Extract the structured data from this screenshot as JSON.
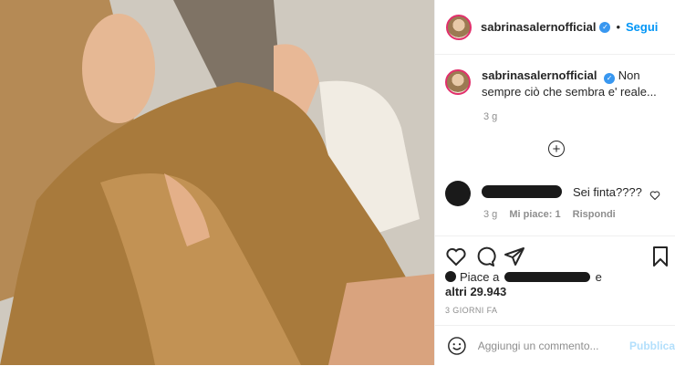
{
  "post": {
    "username": "sabrinasalernofficial",
    "verified": true,
    "follow_label": "Segui",
    "separator": "•",
    "caption": "Non sempre ciò che sembra e' reale...",
    "caption_time": "3 g",
    "comment": {
      "text": "Sei finta????",
      "time": "3 g",
      "likes": "Mi piace: 1",
      "reply": "Rispondi"
    },
    "likes_prefix": "Piace a",
    "likes_suffix": "e",
    "likes_count": "altri 29.943",
    "date": "3 GIORNI FA",
    "add_comment_placeholder": "Aggiungi un commento...",
    "publish_label": "Pubblica"
  },
  "icons": {
    "like": "heart-icon",
    "comment": "comment-icon",
    "share": "share-icon",
    "save": "bookmark-icon",
    "emoji": "emoji-icon",
    "more": "plus-circle-icon"
  },
  "colors": {
    "accent": "#0095f6",
    "verified": "#3897f0",
    "muted": "#8e8e8e",
    "publish_disabled": "#b2dffc"
  }
}
